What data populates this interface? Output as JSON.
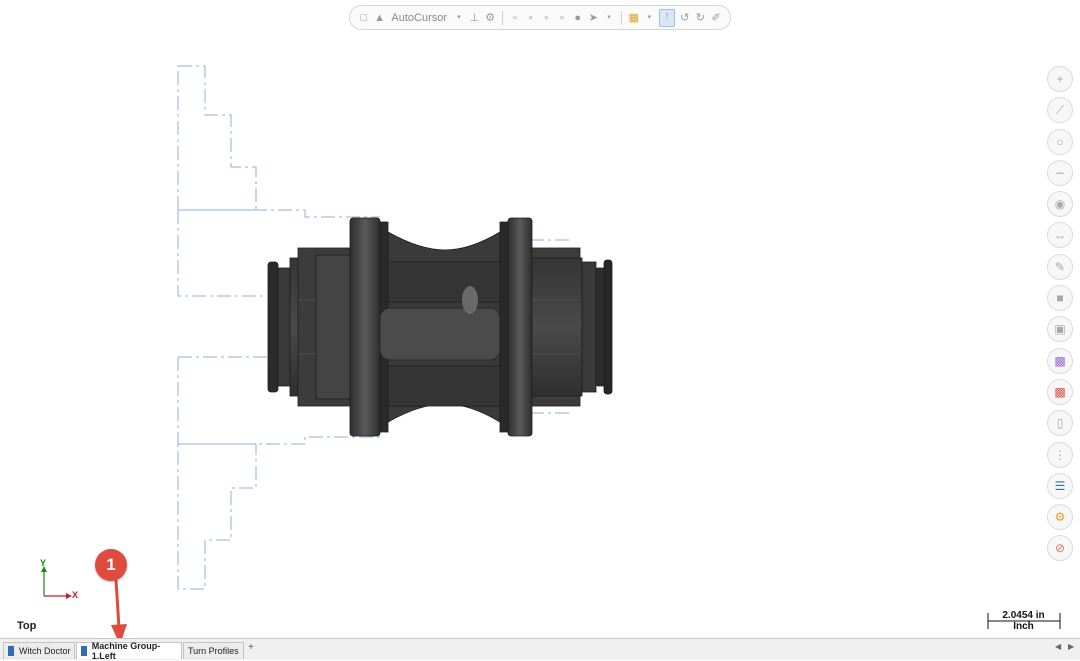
{
  "toolbar": {
    "autocursor_label": "AutoCursor",
    "icons": [
      "lock-icon",
      "cursor-icon",
      "dropdown-icon",
      "tree-icon",
      "gear-icon",
      "select-icon",
      "select-icon",
      "select-icon",
      "select-icon",
      "sphere-icon",
      "arrow-select-icon",
      "dropdown-icon",
      "grid-icon",
      "dropdown-icon",
      "pointer-icon",
      "rotate-icon",
      "rotate-icon",
      "wrench-icon"
    ]
  },
  "rail": {
    "icons": [
      "plus-icon",
      "line-icon",
      "circle-icon",
      "spline-icon",
      "view-icon",
      "dimension-icon",
      "eraser-icon",
      "solid-icon",
      "box-icon",
      "transform-icon",
      "color-icon",
      "chain-icon",
      "points-icon",
      "layers-icon",
      "settings-icon",
      "cancel-icon"
    ]
  },
  "view": {
    "label": "Top",
    "axis_y": "Y",
    "axis_x": "X"
  },
  "scale": {
    "value": "2.0454 in",
    "unit": "Inch"
  },
  "tabs": [
    {
      "label": "Witch Doctor",
      "active": false
    },
    {
      "label": "Machine Group-1.Left",
      "active": true
    },
    {
      "label": "Turn Profiles",
      "active": false
    }
  ],
  "tab_add": "+",
  "callout": {
    "number": "1"
  },
  "colors": {
    "callout": "#e04b3f",
    "part": "#3e3e3e",
    "profile_dash": "#8fb0d6",
    "axis_y": "#1a8a1a",
    "axis_x": "#c0202a"
  }
}
